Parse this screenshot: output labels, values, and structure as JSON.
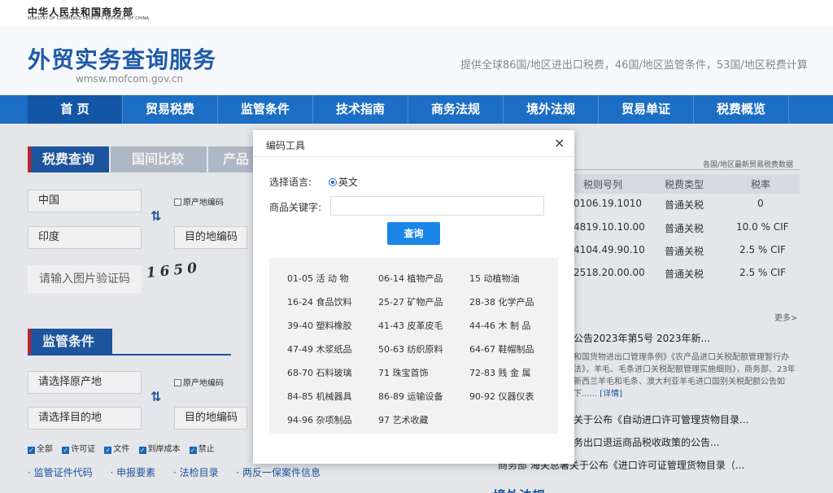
{
  "ministry": {
    "name_cn": "中华人民共和国商务部",
    "name_en": "MINISTRY OF COMMERCE PEOPLE'S REPUBLIC OF CHINA"
  },
  "site": {
    "title": "外贸实务查询服务",
    "domain": "wmsw.mofcom.gov.cn",
    "tagline": "提供全球86国/地区进出口税费，46国/地区监管条件，53国/地区税费计算"
  },
  "nav": [
    "首 页",
    "贸易税费",
    "监管条件",
    "技术指南",
    "商务法规",
    "境外法规",
    "贸易单证",
    "税费概览"
  ],
  "tariff": {
    "tabs": [
      "税费查询",
      "国间比较",
      "产品"
    ],
    "origin": "中国",
    "origin_code_label": "原产地编码",
    "dest": "印度",
    "dest_code_placeholder": "目的地编码",
    "captcha_placeholder": "请输入图片验证码",
    "captcha_text": "1650"
  },
  "supervision": {
    "title": "监管条件",
    "origin_placeholder": "请选择原产地",
    "origin_code_label": "原产地编码",
    "dest_placeholder": "请选择目的地",
    "dest_code_placeholder": "目的地编码",
    "checks": [
      "全部",
      "许可证",
      "文件",
      "到岸成本",
      "禁止"
    ],
    "links": [
      "· 监管证件代码",
      "· 申报要素",
      "· 法检目录",
      "· 两反一保案件信息"
    ]
  },
  "right_panel": {
    "note": "各国/地区最新贸易税费数据",
    "headers": [
      "税则号列",
      "税费类型",
      "税率"
    ],
    "rows": [
      [
        "0106.19.1010",
        "普通关税",
        "0"
      ],
      [
        "4819.10.10.00",
        "普通关税",
        "10.0 % CIF"
      ],
      [
        "4104.49.90.10",
        "普通关税",
        "2.5 % CIF"
      ],
      [
        "2518.20.00.00",
        "普通关税",
        "2.5 % CIF"
      ]
    ],
    "more": "更多>",
    "news": [
      "公告2023年第5号 2023年新...",
      "关于公布《自动进口许可管理货物目录...",
      "务出口退运商品税收政策的公告...",
      "商务部 海关总署关于公布《进口许可证管理货物目录（..."
    ],
    "news_desc": "和国货物进出口管理条例》《农产品进口关税配额管理暂行办法》，羊毛、毛条进口关税配额管理实施细则》，商务部、23年新西兰羊毛和毛条、澳大利亚羊毛进口国别关税配额公告如下......",
    "detail": "[详情]",
    "section_partial": "境外法规"
  },
  "modal": {
    "title": "编码工具",
    "close_glyph": "×",
    "lang_label": "选择语言:",
    "lang_option": "英文",
    "keyword_label": "商品关键字:",
    "keyword_value": "",
    "query": "查询",
    "categories": [
      [
        "01-05 活 动 物",
        "06-14 植物产品",
        "15 动植物油"
      ],
      [
        "16-24 食品饮料",
        "25-27 矿物产品",
        "28-38 化学产品"
      ],
      [
        "39-40 塑料橡胶",
        "41-43 皮革皮毛",
        "44-46 木 制 品"
      ],
      [
        "47-49 木浆纸品",
        "50-63 纺织原料",
        "64-67 鞋帽制品"
      ],
      [
        "68-70 石料玻璃",
        "71 珠宝首饰",
        "72-83 贱 金 属"
      ],
      [
        "84-85 机械器具",
        "86-89 运输设备",
        "90-92 仪器仪表"
      ],
      [
        "94-96 杂项制品",
        "97 艺术收藏"
      ]
    ]
  }
}
